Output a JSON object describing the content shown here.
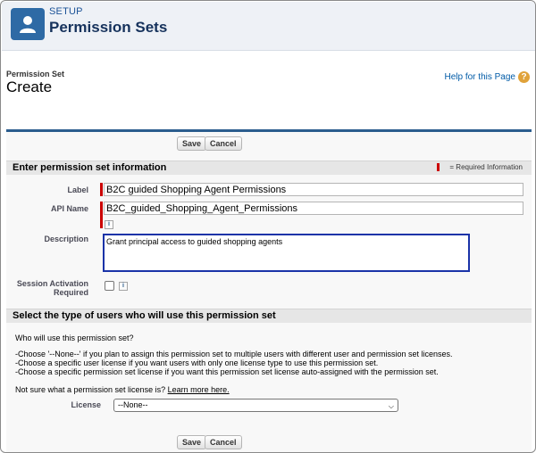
{
  "setup_header": {
    "label": "SETUP",
    "title": "Permission Sets",
    "icon": "user-icon"
  },
  "page": {
    "subtitle": "Permission Set",
    "title": "Create",
    "help_link": "Help for this Page",
    "help_icon": "?"
  },
  "buttons": {
    "save": "Save",
    "cancel": "Cancel"
  },
  "section1": {
    "title": "Enter permission set information",
    "required_legend": "= Required Information"
  },
  "fields": {
    "label": {
      "label": "Label",
      "value": "B2C guided Shopping Agent Permissions"
    },
    "api_name": {
      "label": "API Name",
      "value": "B2C_guided_Shopping_Agent_Permissions",
      "info": "i"
    },
    "description": {
      "label": "Description",
      "value": "Grant principal access to guided shopping agents"
    },
    "session_activation": {
      "label": "Session Activation Required",
      "checked": false,
      "info": "i"
    }
  },
  "section2": {
    "title": "Select the type of users who will use this permission set",
    "question": "Who will use this permission set?",
    "bullets": [
      "-Choose '--None--' if you plan to assign this permission set to multiple users with different user and permission set licenses.",
      "-Choose a specific user license if you want users with only one license type to use this permission set.",
      "-Choose a specific permission set license if you want this permission set license auto-assigned with the permission set."
    ],
    "not_sure": "Not sure what a permission set license is?",
    "learn_more": "Learn more here.",
    "license_label": "License",
    "license_value": "--None--"
  },
  "colors": {
    "header_bg": "#eef1f6",
    "brand_icon": "#2e6aa5",
    "panel_border": "#2b5d8e",
    "required": "#cc0000",
    "link": "#015ba7",
    "focus": "#1a33a8"
  }
}
